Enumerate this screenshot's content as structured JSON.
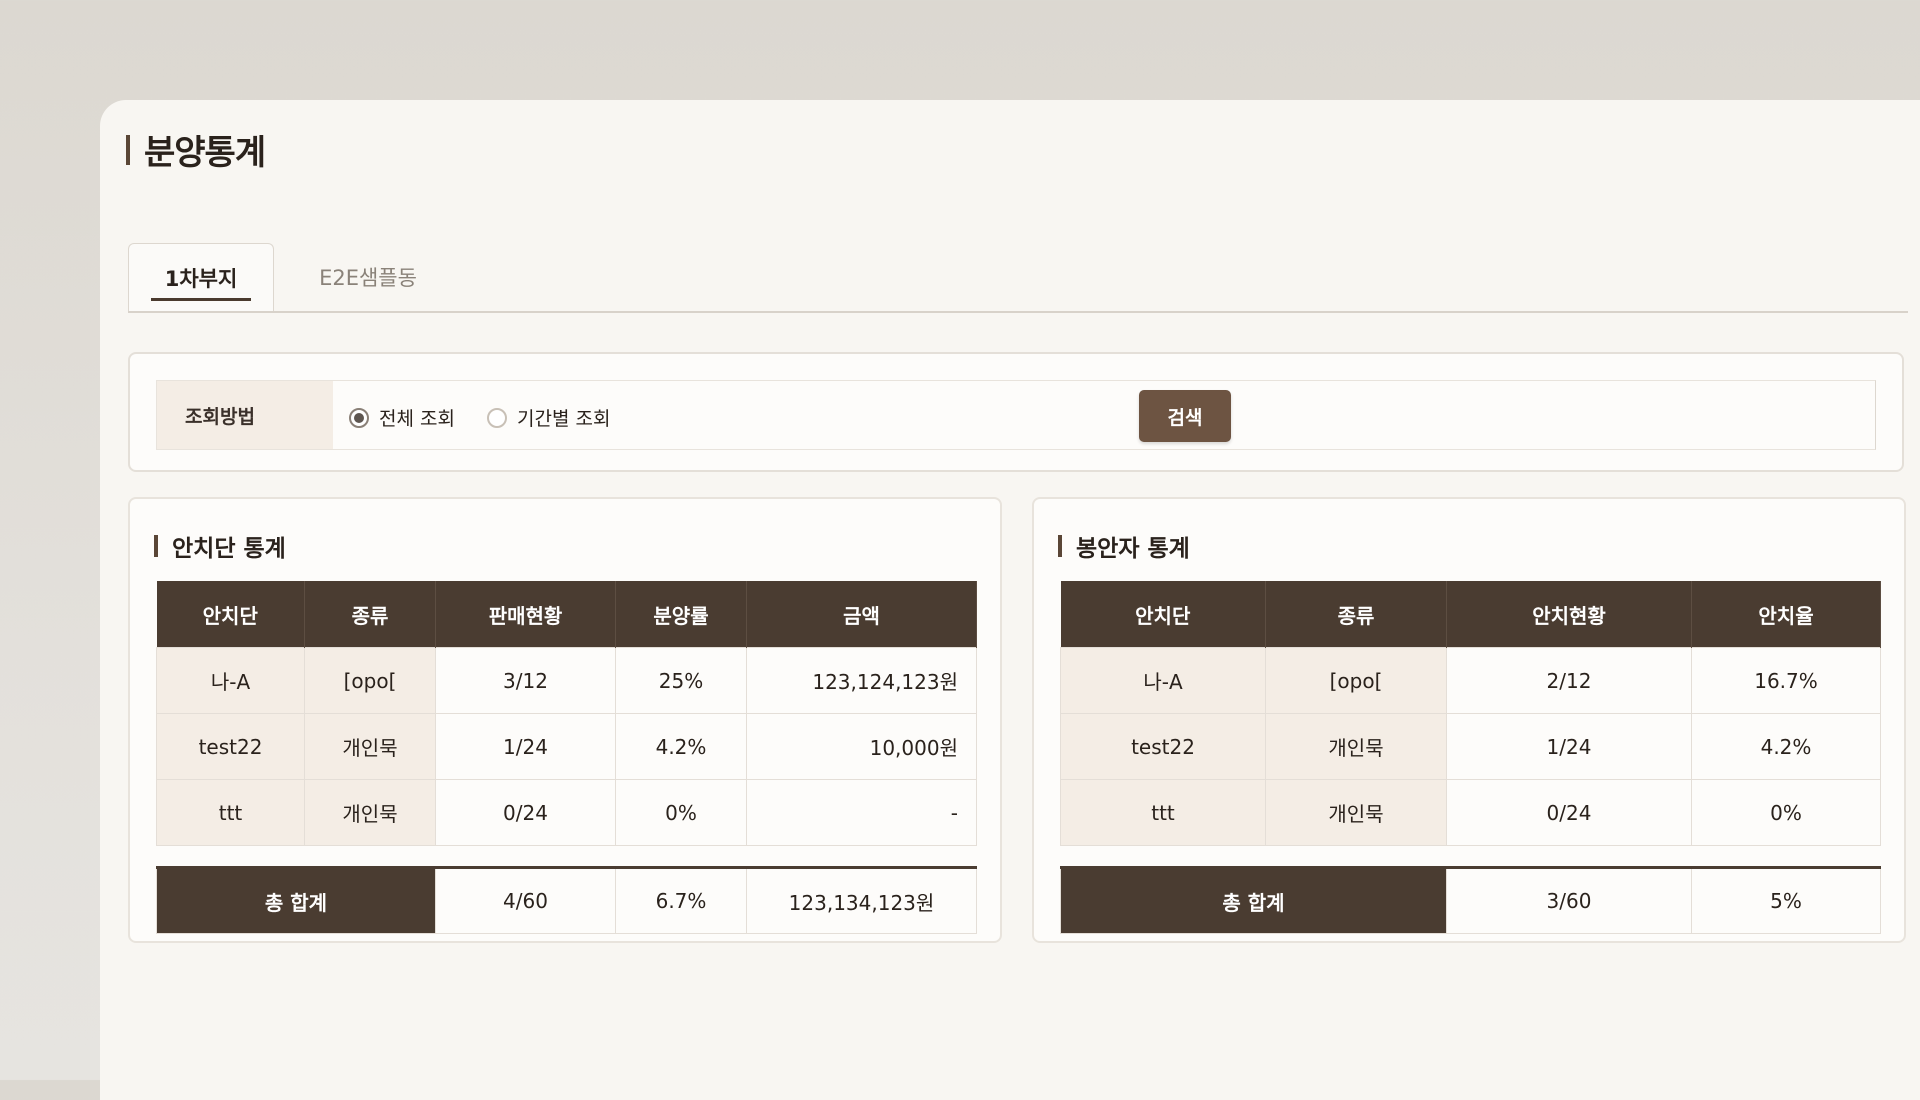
{
  "page": {
    "title": "분양통계"
  },
  "tabs": [
    {
      "label": "1차부지",
      "active": true
    },
    {
      "label": "E2E샘플동",
      "active": false
    }
  ],
  "search": {
    "label": "조회방법",
    "options": [
      {
        "label": "전체 조회",
        "checked": true
      },
      {
        "label": "기간별 조회",
        "checked": false
      }
    ],
    "button": "검색"
  },
  "left": {
    "title": "안치단 통계",
    "headers": [
      "안치단",
      "종류",
      "판매현황",
      "분양률",
      "금액"
    ],
    "rows": [
      [
        "나-A",
        "[opo[",
        "3/12",
        "25%",
        "123,124,123원"
      ],
      [
        "test22",
        "개인묵",
        "1/24",
        "4.2%",
        "10,000원"
      ],
      [
        "ttt",
        "개인묵",
        "0/24",
        "0%",
        "-"
      ]
    ],
    "total": {
      "label": "총 합계",
      "sales": "4/60",
      "rate": "6.7%",
      "amount": "123,134,123원"
    }
  },
  "right": {
    "title": "봉안자 통계",
    "headers": [
      "안치단",
      "종류",
      "안치현황",
      "안치율"
    ],
    "rows": [
      [
        "나-A",
        "[opo[",
        "2/12",
        "16.7%"
      ],
      [
        "test22",
        "개인묵",
        "1/24",
        "4.2%"
      ],
      [
        "ttt",
        "개인묵",
        "0/24",
        "0%"
      ]
    ],
    "total": {
      "label": "총 합계",
      "status": "3/60",
      "rate": "5%"
    }
  },
  "colors": {
    "brand": "#4a3c31",
    "button": "#6d5442",
    "label_bg": "#f4ede5"
  }
}
